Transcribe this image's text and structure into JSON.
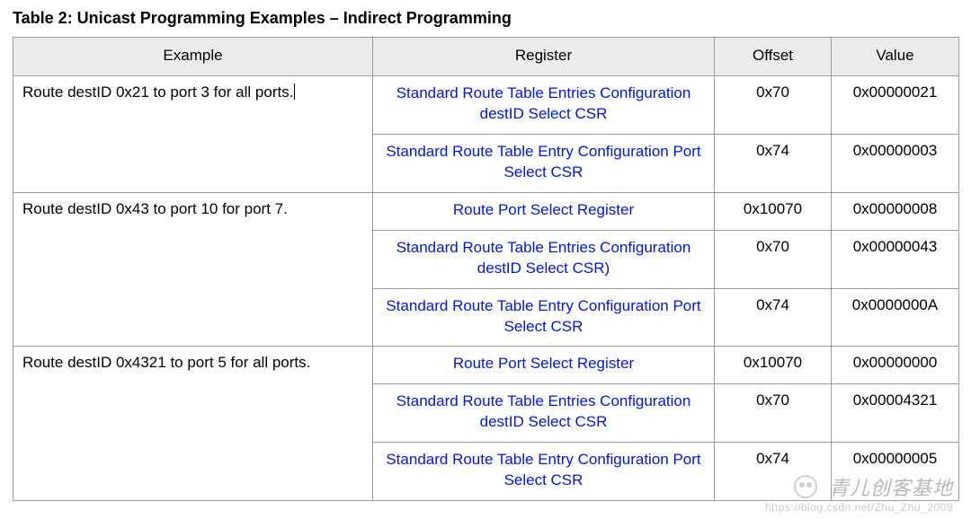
{
  "caption": "Table 2: Unicast Programming Examples – Indirect Programming",
  "columns": {
    "example": "Example",
    "register": "Register",
    "offset": "Offset",
    "value": "Value"
  },
  "groups": [
    {
      "example": "Route destID 0x21 to port 3 for all ports.",
      "has_cursor": true,
      "rows": [
        {
          "register": "Standard Route Table Entries Configuration destID Select CSR",
          "offset": "0x70",
          "value": "0x00000021"
        },
        {
          "register": "Standard Route Table Entry Configuration Port Select CSR",
          "offset": "0x74",
          "value": "0x00000003"
        }
      ]
    },
    {
      "example": "Route destID 0x43 to port 10 for port 7.",
      "has_cursor": false,
      "rows": [
        {
          "register": "Route Port Select Register",
          "offset": "0x10070",
          "value": "0x00000008"
        },
        {
          "register": "Standard Route Table Entries Configuration destID Select CSR)",
          "offset": "0x70",
          "value": "0x00000043"
        },
        {
          "register": "Standard Route Table Entry Configuration Port Select CSR",
          "offset": "0x74",
          "value": "0x0000000A"
        }
      ]
    },
    {
      "example": "Route destID 0x4321 to port 5 for all ports.",
      "has_cursor": false,
      "rows": [
        {
          "register": "Route Port Select Register",
          "offset": "0x10070",
          "value": "0x00000000"
        },
        {
          "register": "Standard Route Table Entries Configuration destID Select CSR",
          "offset": "0x70",
          "value": "0x00004321"
        },
        {
          "register": "Standard Route Table Entry Configuration Port Select CSR",
          "offset": "0x74",
          "value": "0x00000005"
        }
      ]
    }
  ],
  "watermark": {
    "title": "青儿创客基地",
    "url": "https://blog.csdn.net/Zhu_Zhu_2009"
  }
}
